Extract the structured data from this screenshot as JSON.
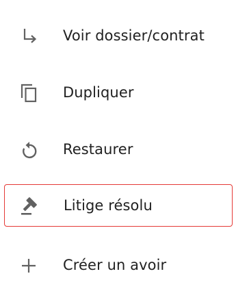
{
  "menu": {
    "items": [
      {
        "label": "Voir dossier/contrat",
        "icon": "subdirectory-arrow-right-icon"
      },
      {
        "label": "Dupliquer",
        "icon": "content-copy-icon"
      },
      {
        "label": "Restaurer",
        "icon": "restore-icon"
      },
      {
        "label": "Litige résolu",
        "icon": "gavel-icon",
        "highlighted": true
      },
      {
        "label": "Créer un avoir",
        "icon": "add-icon"
      }
    ]
  },
  "colors": {
    "text": "#212121",
    "icon": "#616161",
    "highlight_border": "#e53935"
  }
}
